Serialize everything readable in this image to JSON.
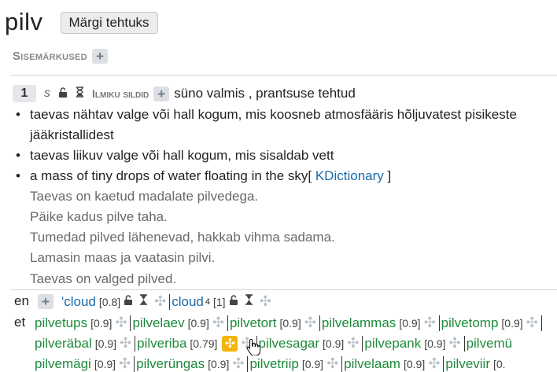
{
  "header": {
    "word": "pilv",
    "mark_button": "Märgi tehtuks"
  },
  "internal_notes": {
    "label": "Sisemärkused",
    "add": "+"
  },
  "meaning": {
    "number": "1",
    "register": "s",
    "public_labels": "Ilmiku sildid",
    "add": "+",
    "publishing_note": "süno valmis , prantsuse tehtud",
    "definitions": [
      {
        "line1": "taevas nähtav valge või hall kogum, mis koosneb atmosfääris hõljuvatest pisikeste",
        "line2": "jääkristallidest"
      },
      {
        "line1": "taevas liikuv valge või hall kogum, mis sisaldab vett"
      },
      {
        "line1": "a mass of tiny drops of water floating in the sky[",
        "source": " KDictionary ",
        "close": "]"
      }
    ],
    "examples": [
      "Taevas on kaetud madalate pilvedega.",
      "Päike kadus pilve taha.",
      "Tumedad pilved lähenevad, hakkab vihma sadama.",
      "Lamasin maas ja vaatasin pilvi.",
      "Taevas on valged pilved."
    ]
  },
  "translations": {
    "en": {
      "lang": "en",
      "add": "+",
      "items": [
        {
          "word": "'cloud",
          "weight": "[0.8]"
        },
        {
          "word": "cloud",
          "sup": "4",
          "weight": "[1]"
        }
      ]
    },
    "et": {
      "lang": "et",
      "rows": [
        [
          {
            "word": "pilvetups",
            "weight": "[0.9]"
          },
          {
            "word": "pilvelaev",
            "weight": "[0.9]"
          },
          {
            "word": "pilvetort",
            "weight": "[0.9]"
          },
          {
            "word": "pilvelammas",
            "weight": "[0.9]"
          },
          {
            "word": "pilvetomp",
            "weight": "[0.9]"
          }
        ],
        [
          {
            "word": "pilveräbal",
            "weight": "[0.9]"
          },
          {
            "word": "pilveriba",
            "weight": "[0.79]"
          },
          {
            "word": "pilvesagar",
            "weight": "[0.9]"
          },
          {
            "word": "pilvepank",
            "weight": "[0.9]"
          },
          {
            "word": "pilvemü",
            "weight": ""
          }
        ],
        [
          {
            "word": "pilvemägi",
            "weight": "[0.9]"
          },
          {
            "word": "pilverüngas",
            "weight": "[0.9]"
          },
          {
            "word": "pilvetriip",
            "weight": "[0.9]"
          },
          {
            "word": "pilvelaam",
            "weight": "[0.9]"
          },
          {
            "word": "pilveviir",
            "weight": "[0."
          }
        ]
      ]
    }
  },
  "colors": {
    "link_green": "#1e8a3a",
    "link_blue": "#1a6aa8",
    "highlight": "#f5b40a"
  }
}
